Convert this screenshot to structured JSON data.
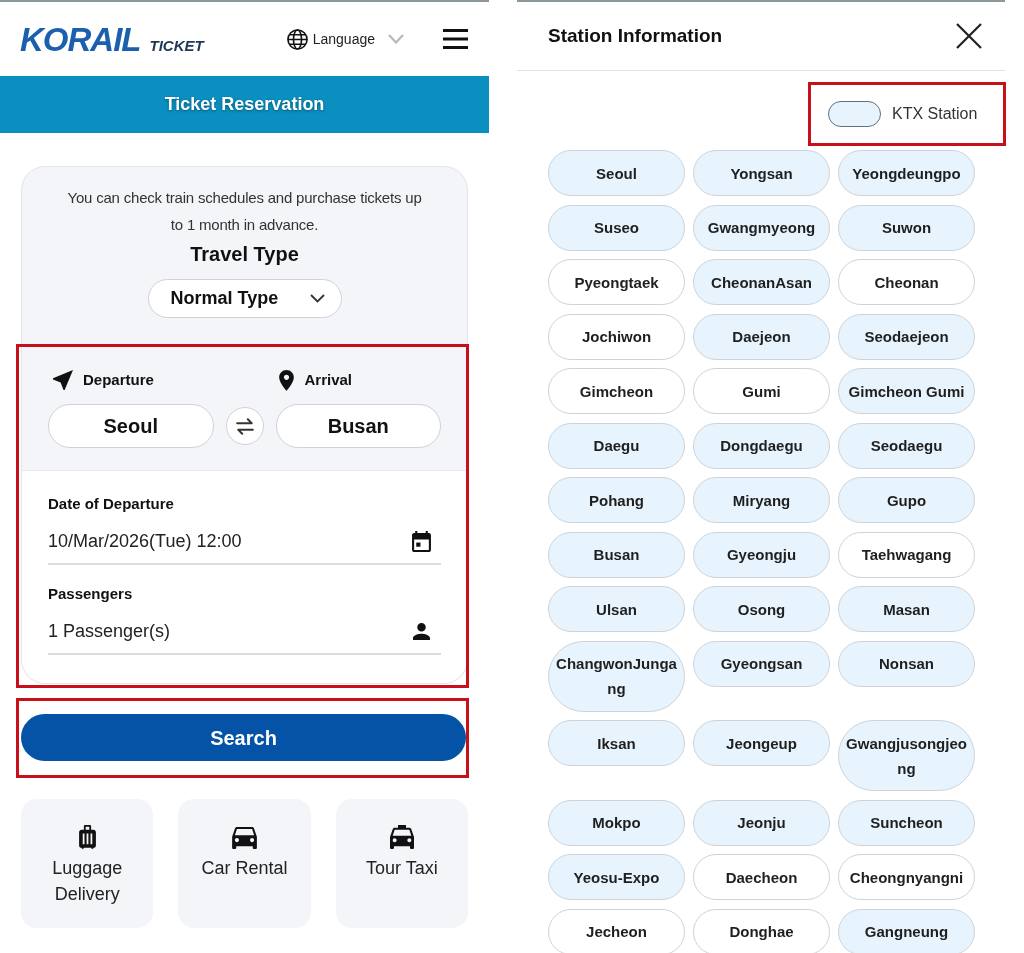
{
  "header": {
    "logo": "KORAIL",
    "logo_suffix": "TICKET",
    "language": "Language"
  },
  "banner": {
    "title": "Ticket Reservation"
  },
  "reservation_card": {
    "notice": "You can check train schedules and purchase tickets up to 1 month in advance.",
    "travel_type": {
      "label": "Travel Type",
      "value": "Normal Type"
    },
    "trip_details": {
      "highlighted": true,
      "departure": {
        "label": "Departure",
        "value": "Seoul"
      },
      "arrival": {
        "label": "Arrival",
        "value": "Busan"
      },
      "date": {
        "label": "Date of Departure",
        "value": "10/Mar/2026(Tue) 12:00"
      },
      "passengers": {
        "label": "Passengers",
        "value": "1 Passenger(s)"
      }
    }
  },
  "search_button": {
    "label": "Search",
    "highlighted": true
  },
  "services": [
    {
      "kind": "luggage",
      "label": "Luggage Delivery"
    },
    {
      "kind": "car",
      "label": "Car Rental"
    },
    {
      "kind": "taxi",
      "label": "Tour Taxi"
    }
  ],
  "station_panel": {
    "title": "Station Information",
    "legend": {
      "label": "KTX Station",
      "highlighted": true
    },
    "stations": [
      {
        "name": "Seoul",
        "ktx": true
      },
      {
        "name": "Yongsan",
        "ktx": true
      },
      {
        "name": "Yeongdeungpo",
        "ktx": true
      },
      {
        "name": "Suseo",
        "ktx": true
      },
      {
        "name": "Gwangmyeong",
        "ktx": true
      },
      {
        "name": "Suwon",
        "ktx": true
      },
      {
        "name": "Pyeongtaek",
        "ktx": false
      },
      {
        "name": "CheonanAsan",
        "ktx": true
      },
      {
        "name": "Cheonan",
        "ktx": false
      },
      {
        "name": "Jochiwon",
        "ktx": false
      },
      {
        "name": "Daejeon",
        "ktx": true
      },
      {
        "name": "Seodaejeon",
        "ktx": true
      },
      {
        "name": "Gimcheon",
        "ktx": false
      },
      {
        "name": "Gumi",
        "ktx": false
      },
      {
        "name": "Gimcheon Gumi",
        "ktx": true
      },
      {
        "name": "Daegu",
        "ktx": true
      },
      {
        "name": "Dongdaegu",
        "ktx": true
      },
      {
        "name": "Seodaegu",
        "ktx": true
      },
      {
        "name": "Pohang",
        "ktx": true
      },
      {
        "name": "Miryang",
        "ktx": true
      },
      {
        "name": "Gupo",
        "ktx": true
      },
      {
        "name": "Busan",
        "ktx": true
      },
      {
        "name": "Gyeongju",
        "ktx": true
      },
      {
        "name": "Taehwagang",
        "ktx": false
      },
      {
        "name": "Ulsan",
        "ktx": true
      },
      {
        "name": "Osong",
        "ktx": true
      },
      {
        "name": "Masan",
        "ktx": true
      },
      {
        "name": "ChangwonJungang",
        "ktx": true
      },
      {
        "name": "Gyeongsan",
        "ktx": true
      },
      {
        "name": "Nonsan",
        "ktx": true
      },
      {
        "name": "Iksan",
        "ktx": true
      },
      {
        "name": "Jeongeup",
        "ktx": true
      },
      {
        "name": "Gwangjusongjeong",
        "ktx": true
      },
      {
        "name": "Mokpo",
        "ktx": true
      },
      {
        "name": "Jeonju",
        "ktx": true
      },
      {
        "name": "Suncheon",
        "ktx": true
      },
      {
        "name": "Yeosu-Expo",
        "ktx": true
      },
      {
        "name": "Daecheon",
        "ktx": false
      },
      {
        "name": "Cheongnyangni",
        "ktx": false
      },
      {
        "name": "Jecheon",
        "ktx": false
      },
      {
        "name": "Donghae",
        "ktx": false
      },
      {
        "name": "Gangneung",
        "ktx": true
      }
    ]
  }
}
